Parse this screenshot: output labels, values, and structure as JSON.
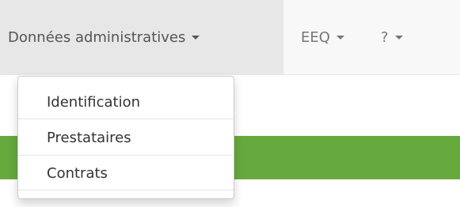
{
  "navbar": {
    "items": [
      {
        "label": "Données administratives",
        "active": true,
        "has_caret": true
      },
      {
        "label": "EEQ",
        "active": false,
        "has_caret": true
      },
      {
        "label": "?",
        "active": false,
        "has_caret": true
      }
    ]
  },
  "dropdown": {
    "open": true,
    "items": [
      {
        "label": "Identification"
      },
      {
        "label": "Prestataires"
      },
      {
        "label": "Contrats"
      }
    ]
  },
  "colors": {
    "navbar_bg": "#f8f8f8",
    "active_bg": "#e7e7e7",
    "accent_green": "#66aa3d"
  }
}
